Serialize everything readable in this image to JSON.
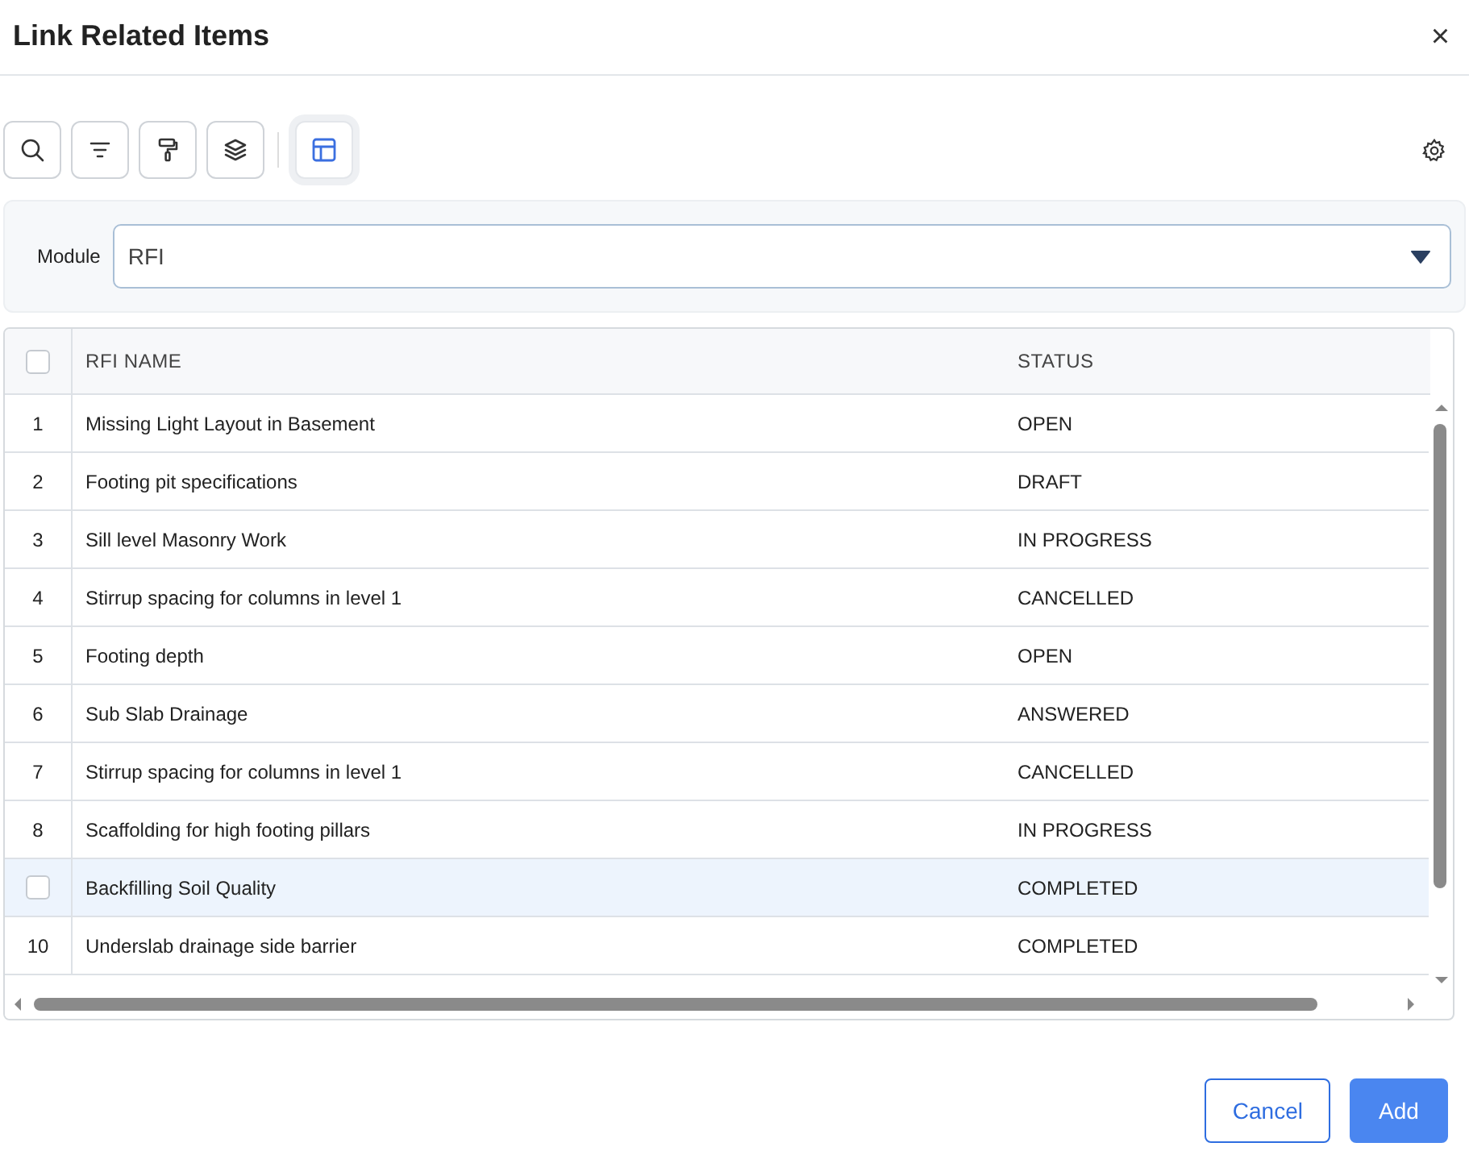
{
  "dialog": {
    "title": "Link Related Items",
    "close": "×"
  },
  "toolbar": {
    "tools": [
      {
        "kind": "search",
        "selected": false
      },
      {
        "kind": "filter",
        "selected": false
      },
      {
        "kind": "paint",
        "selected": false
      },
      {
        "kind": "layers",
        "selected": false
      },
      {
        "kind": "table",
        "selected": true
      }
    ]
  },
  "module": {
    "label": "Module",
    "value": "RFI"
  },
  "table": {
    "select_all": false,
    "columns": [
      "RFI NAME",
      "STATUS"
    ],
    "rows": [
      {
        "number": "1",
        "name": "Missing Light Layout in Basement",
        "status": "OPEN",
        "hovered": false
      },
      {
        "number": "2",
        "name": "Footing pit specifications",
        "status": "DRAFT",
        "hovered": false
      },
      {
        "number": "3",
        "name": "Sill level Masonry Work",
        "status": "IN PROGRESS",
        "hovered": false
      },
      {
        "number": "4",
        "name": "Stirrup spacing for columns in level 1",
        "status": "CANCELLED",
        "hovered": false
      },
      {
        "number": "5",
        "name": "Footing depth",
        "status": "OPEN",
        "hovered": false
      },
      {
        "number": "6",
        "name": "Sub Slab Drainage",
        "status": "ANSWERED",
        "hovered": false
      },
      {
        "number": "7",
        "name": "Stirrup spacing for columns in level 1",
        "status": "CANCELLED",
        "hovered": false
      },
      {
        "number": "8",
        "name": "Scaffolding for high footing pillars",
        "status": "IN PROGRESS",
        "hovered": false
      },
      {
        "name": "Backfilling Soil Quality",
        "status": "COMPLETED",
        "hovered": true,
        "checked": false
      },
      {
        "number": "10",
        "name": "Underslab drainage side barrier",
        "status": "COMPLETED",
        "hovered": false
      }
    ]
  },
  "buttons": [
    {
      "label": "Cancel",
      "kind": "secondary"
    },
    {
      "label": "Add",
      "kind": "primary"
    }
  ]
}
